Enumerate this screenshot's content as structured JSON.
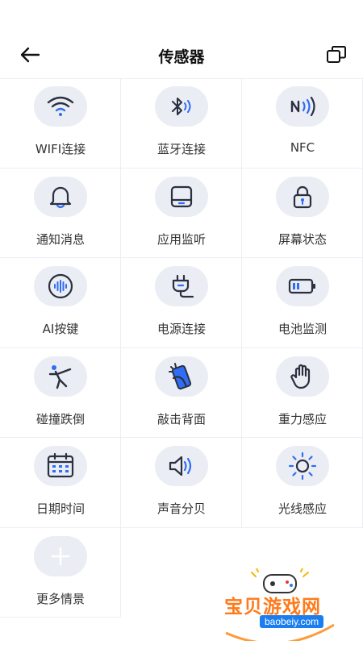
{
  "header": {
    "title": "传感器"
  },
  "colors": {
    "icon_bg": "#eaedf3",
    "icon_stroke": "#2b3040",
    "icon_accent": "#2f6df6",
    "divider": "#eceef2"
  },
  "items": [
    {
      "label": "WIFI连接",
      "icon": "wifi-icon"
    },
    {
      "label": "蓝牙连接",
      "icon": "bluetooth-icon"
    },
    {
      "label": "NFC",
      "icon": "nfc-icon"
    },
    {
      "label": "通知消息",
      "icon": "bell-icon"
    },
    {
      "label": "应用监听",
      "icon": "tablet-icon"
    },
    {
      "label": "屏幕状态",
      "icon": "lock-icon"
    },
    {
      "label": "AI按键",
      "icon": "voice-icon"
    },
    {
      "label": "电源连接",
      "icon": "plug-icon"
    },
    {
      "label": "电池监测",
      "icon": "battery-icon"
    },
    {
      "label": "碰撞跌倒",
      "icon": "fall-icon"
    },
    {
      "label": "敲击背面",
      "icon": "tap-phone-icon"
    },
    {
      "label": "重力感应",
      "icon": "hand-icon"
    },
    {
      "label": "日期时间",
      "icon": "calendar-icon"
    },
    {
      "label": "声音分贝",
      "icon": "speaker-icon"
    },
    {
      "label": "光线感应",
      "icon": "sun-icon"
    },
    {
      "label": "更多情景",
      "icon": "plus-icon"
    }
  ],
  "watermark": {
    "text": "宝贝游戏网",
    "url": "baobeiy.com"
  }
}
